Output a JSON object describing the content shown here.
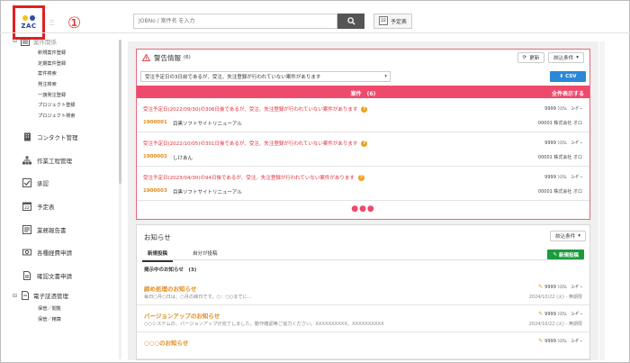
{
  "logo": {
    "text": "ZAC",
    "dot_colors": [
      "#f2c11a",
      "#2f4f9f"
    ]
  },
  "marker": "①",
  "menu_stub": "三",
  "search": {
    "placeholder": "JOBNo / 案件名 を入力"
  },
  "schedule": {
    "icon_text": "22",
    "label": "予定表"
  },
  "sidebar": {
    "group_label": "案件関係",
    "sub_items": [
      "新規案件登録",
      "定期案件登録",
      "案件検索",
      "発注検索",
      "一旗発注登録",
      "プロジェクト登録",
      "プロジェクト検索"
    ],
    "items": [
      {
        "label": "コンタクト管理",
        "icon": "building-icon"
      },
      {
        "label": "作業工程管理",
        "icon": "org-chart-icon"
      },
      {
        "label": "承認",
        "icon": "checkbox-icon"
      },
      {
        "label": "予定表",
        "icon": "calendar-icon"
      },
      {
        "label": "業務報告書",
        "icon": "report-icon"
      },
      {
        "label": "各種経費申請",
        "icon": "money-icon"
      },
      {
        "label": "確認文書申請",
        "icon": "document-icon"
      }
    ],
    "group2_label": "電子証憑管理",
    "group2_sub": [
      "保管／閲覧",
      "保管／精算"
    ]
  },
  "alert": {
    "title": "警告情報",
    "count": "(6)",
    "refresh_label": "更新",
    "filter_label": "絞込条件",
    "select_value": "受注予定日の3日前であるが、受注、失注登録が行われていない案件があります",
    "csv_label": "CSV",
    "bar_label": "案件　(6)",
    "show_all_label": "全件表示する",
    "rows": [
      {
        "message": "受注予定日(2022/09/30)の306日後であるが、受注、失注登録が行われていない案件があります",
        "code": "1900001",
        "name": "目黒ソフトサイトリニューアル",
        "user": "9999 ｼｽﾃﾑ　ﾕｰｻﾞｰ",
        "company": "00001 株式会社 オロ"
      },
      {
        "message": "受注予定日(2022/10/05)の301日後であるが、受注、失注登録が行われていない案件があります",
        "code": "1900002",
        "name": "しけあん",
        "user": "9999 ｼｽﾃﾑ　ﾕｰｻﾞｰ",
        "company": "00001 株式会社 オロ"
      },
      {
        "message": "受注予定日(2023/04/30)の94日後であるが、受注、失注登録が行われていない案件があります",
        "code": "1900003",
        "name": "目黒ソフトサイトリニューアル",
        "user": "9999 ｼｽﾃﾑ　ﾕｰｻﾞｰ",
        "company": "00001 株式会社 オロ"
      }
    ],
    "more": "●●●"
  },
  "news": {
    "title": "お知らせ",
    "filter_label": "絞込条件",
    "tabs": [
      "新規投稿",
      "自分が投稿"
    ],
    "new_post_label": "新規投稿",
    "posted_heading": "掲示中のお知らせ　(3)",
    "items": [
      {
        "title": "締め処理のお知らせ",
        "body": "毎日○月○日は、○月の締日です。○：○○までに…",
        "user": "9999 ｼｽﾃﾑ　ﾕｰｻﾞｰ",
        "date": "2024/10/22 (火) - 無期限"
      },
      {
        "title": "バージョンアップのお知らせ",
        "body": "○○システムの、バージョンアップが完了しました。動作確認等ご協力ください。XXXXXXXXXX、XXXXXXXXXX",
        "user": "9999 ｼｽﾃﾑ　ﾕｰｻﾞｰ",
        "date": "2024/10/22 (火) - 無期限"
      },
      {
        "title": "○○○のお知らせ",
        "body": "",
        "user": "9999 ｼｽﾃﾑ　ﾕｰｻﾞｰ",
        "date": ""
      }
    ]
  }
}
